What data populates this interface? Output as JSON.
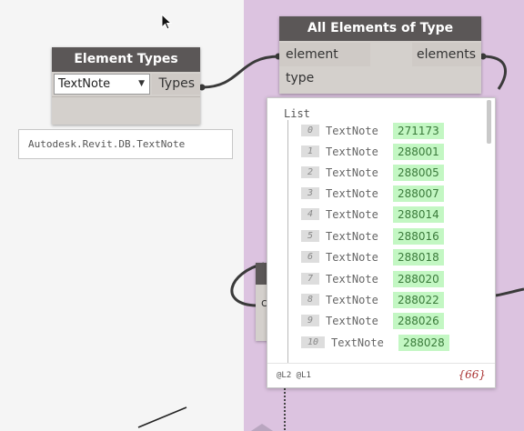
{
  "nodes": {
    "element_types": {
      "title": "Element Types",
      "dropdown_value": "TextNote",
      "output_port": "Types",
      "preview_value": "Autodesk.Revit.DB.TextNote"
    },
    "all_elements_of_type": {
      "title": "All Elements of Type",
      "input_port": "element type",
      "output_port": "elements"
    },
    "partial_node": {
      "port_label": "c"
    }
  },
  "watch": {
    "list_label": "List",
    "items": [
      {
        "index": "0",
        "type": "TextNote",
        "id": "271173"
      },
      {
        "index": "1",
        "type": "TextNote",
        "id": "288001"
      },
      {
        "index": "2",
        "type": "TextNote",
        "id": "288005"
      },
      {
        "index": "3",
        "type": "TextNote",
        "id": "288007"
      },
      {
        "index": "4",
        "type": "TextNote",
        "id": "288014"
      },
      {
        "index": "5",
        "type": "TextNote",
        "id": "288016"
      },
      {
        "index": "6",
        "type": "TextNote",
        "id": "288018"
      },
      {
        "index": "7",
        "type": "TextNote",
        "id": "288020"
      },
      {
        "index": "8",
        "type": "TextNote",
        "id": "288022"
      },
      {
        "index": "9",
        "type": "TextNote",
        "id": "288026"
      },
      {
        "index": "10",
        "type": "TextNote",
        "id": "288028"
      }
    ],
    "levels_label": "@L2 @L1",
    "count_label": "{66}"
  },
  "icons": {
    "dropdown": "chevron-down-icon",
    "cursor": "mouse-pointer-icon"
  },
  "colors": {
    "node_header": "#5b5757",
    "node_body": "#d4d0cc",
    "group_background": "#dcc3e0",
    "canvas": "#f5f5f5",
    "id_highlight": "#c3f7c3",
    "wire": "#3a3a3a"
  }
}
